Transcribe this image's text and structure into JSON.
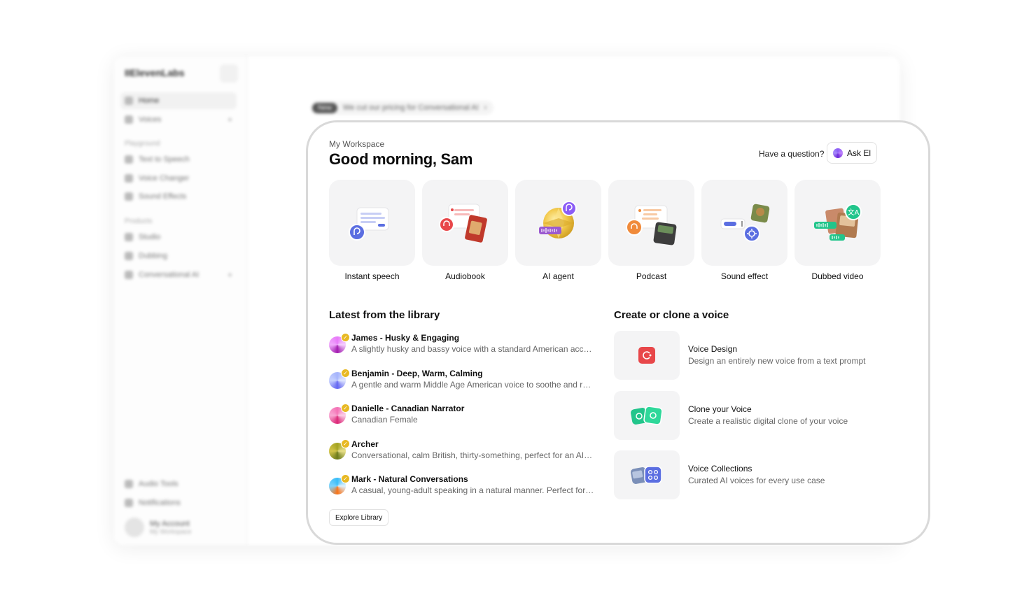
{
  "background_app": {
    "logo": "IIElevenLabs",
    "banner_badge": "New",
    "banner_text": "We cut our pricing for Conversational AI",
    "nav": {
      "home": "Home",
      "voices": "Voices",
      "playground_section": "Playground",
      "text_to_speech": "Text to Speech",
      "voice_changer": "Voice Changer",
      "sound_effects": "Sound Effects",
      "products_section": "Products",
      "studio": "Studio",
      "dubbing": "Dubbing",
      "conversational_ai": "Conversational AI",
      "audio_tools": "Audio Tools",
      "notifications": "Notifications"
    },
    "account": {
      "name": "My Account",
      "workspace": "My Workspace"
    }
  },
  "header": {
    "workspace": "My Workspace",
    "greeting": "Good morning, Sam",
    "question": "Have a question?",
    "ask_button": "Ask El"
  },
  "quick_actions": [
    {
      "label": "Instant speech",
      "icon": "speech-bubble-icon"
    },
    {
      "label": "Audiobook",
      "icon": "book-icon"
    },
    {
      "label": "AI agent",
      "icon": "agent-orb-icon"
    },
    {
      "label": "Podcast",
      "icon": "podcast-icon"
    },
    {
      "label": "Sound effect",
      "icon": "sound-effect-icon"
    },
    {
      "label": "Dubbed video",
      "icon": "translate-icon"
    }
  ],
  "library": {
    "title": "Latest from the library",
    "items": [
      {
        "name": "James - Husky & Engaging",
        "description": "A slightly husky and bassy voice with a standard American accent…"
      },
      {
        "name": "Benjamin - Deep, Warm, Calming",
        "description": "A gentle and warm Middle Age American voice to soothe and rela…"
      },
      {
        "name": "Danielle - Canadian Narrator",
        "description": "Canadian Female"
      },
      {
        "name": "Archer",
        "description": "Conversational, calm British, thirty-something, perfect for an AI…"
      },
      {
        "name": "Mark - Natural Conversations",
        "description": "A casual, young-adult speaking in a natural manner. Perfect for…"
      }
    ],
    "explore_button": "Explore Library"
  },
  "create": {
    "title": "Create or clone a voice",
    "items": [
      {
        "name": "Voice Design",
        "description": "Design an entirely new voice from a text prompt"
      },
      {
        "name": "Clone your Voice",
        "description": "Create a realistic digital clone of your voice"
      },
      {
        "name": "Voice Collections",
        "description": "Curated AI voices for every use case"
      }
    ]
  },
  "colors": {
    "tile_bg": "#f4f4f5",
    "accent_blue": "#5b6ee1",
    "accent_red": "#e8474a",
    "accent_green": "#22c58b",
    "accent_purple": "#8b5cf6",
    "accent_orange": "#f08a3a",
    "gold": "#e8b923"
  }
}
